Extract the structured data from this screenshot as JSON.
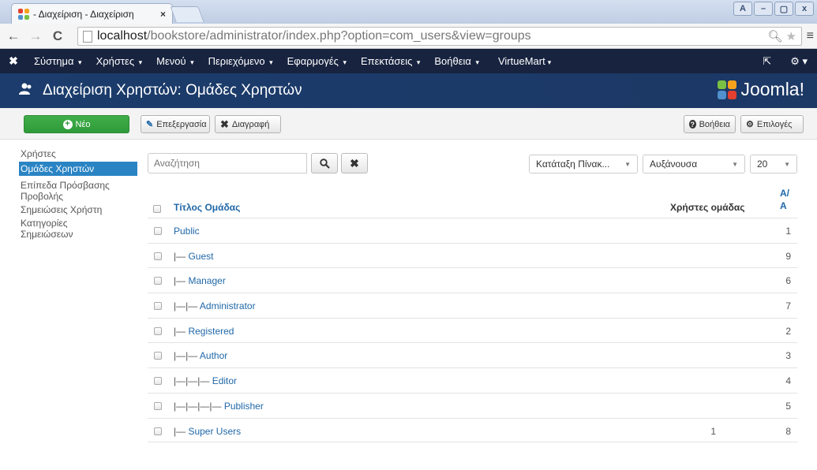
{
  "browser": {
    "tab_title": "- Διαχείριση - Διαχείριση",
    "tab_close": "×",
    "url_host": "localhost",
    "url_path": "/bookstore/administrator/index.php?option=com_users&view=groups",
    "window_buttons": [
      "A",
      "–",
      "▢",
      "x"
    ]
  },
  "topmenu": {
    "items": [
      {
        "label": "Σύστημα",
        "caret": true
      },
      {
        "label": "Χρήστες",
        "caret": true
      },
      {
        "label": "Μενού",
        "caret": true
      },
      {
        "label": "Περιεχόμενο",
        "caret": true
      },
      {
        "label": "Εφαρμογές",
        "caret": true
      },
      {
        "label": "Επεκτάσεις",
        "caret": true
      },
      {
        "label": "Βοήθεια",
        "caret": true
      },
      {
        "label": "VirtueMart",
        "caret": true
      }
    ]
  },
  "header": {
    "title": "Διαχείριση Χρηστών: Ομάδες Χρηστών",
    "brand": "Joomla!"
  },
  "toolbar": {
    "new_label": "Νέο",
    "edit_label": "Επεξεργασία",
    "delete_label": "Διαγραφή",
    "help_label": "Βοήθεια",
    "options_label": "Επιλογές"
  },
  "sidebar": {
    "items": [
      {
        "label": "Χρήστες",
        "active": false
      },
      {
        "label": "Ομάδες Χρηστών",
        "active": true
      },
      {
        "label": "Επίπεδα Πρόσβασης",
        "active": false
      },
      {
        "label": "Προβολής",
        "active": false
      },
      {
        "label": "Σημειώσεις Χρήστη",
        "active": false
      },
      {
        "label": "Κατηγορίες",
        "active": false
      },
      {
        "label": "Σημειώσεων",
        "active": false
      }
    ]
  },
  "filters": {
    "search_placeholder": "Αναζήτηση",
    "order_by": "Κατάταξη Πίνακ...",
    "direction": "Αυξάνουσα",
    "limit": "20"
  },
  "table": {
    "col_title": "Τίτλος Ομάδας",
    "col_users": "Χρήστες ομάδας",
    "col_id_line1": "Α/",
    "col_id_line2": "Α",
    "rows": [
      {
        "tree": "",
        "title": "Public",
        "users": "",
        "id": "1"
      },
      {
        "tree": "|— ",
        "title": "Guest",
        "users": "",
        "id": "9"
      },
      {
        "tree": "|— ",
        "title": "Manager",
        "users": "",
        "id": "6"
      },
      {
        "tree": "|—|— ",
        "title": "Administrator",
        "users": "",
        "id": "7"
      },
      {
        "tree": "|— ",
        "title": "Registered",
        "users": "",
        "id": "2"
      },
      {
        "tree": "|—|— ",
        "title": "Author",
        "users": "",
        "id": "3"
      },
      {
        "tree": "|—|—|— ",
        "title": "Editor",
        "users": "",
        "id": "4"
      },
      {
        "tree": "|—|—|—|— ",
        "title": "Publisher",
        "users": "",
        "id": "5"
      },
      {
        "tree": "|— ",
        "title": "Super Users",
        "users": "1",
        "id": "8"
      }
    ]
  },
  "colors": {
    "topmenu_bg": "#17233f",
    "header_bg": "#1b3c6c",
    "new_button": "#2f9a39",
    "link": "#2068a8",
    "active_sidebar": "#2a84c4"
  }
}
